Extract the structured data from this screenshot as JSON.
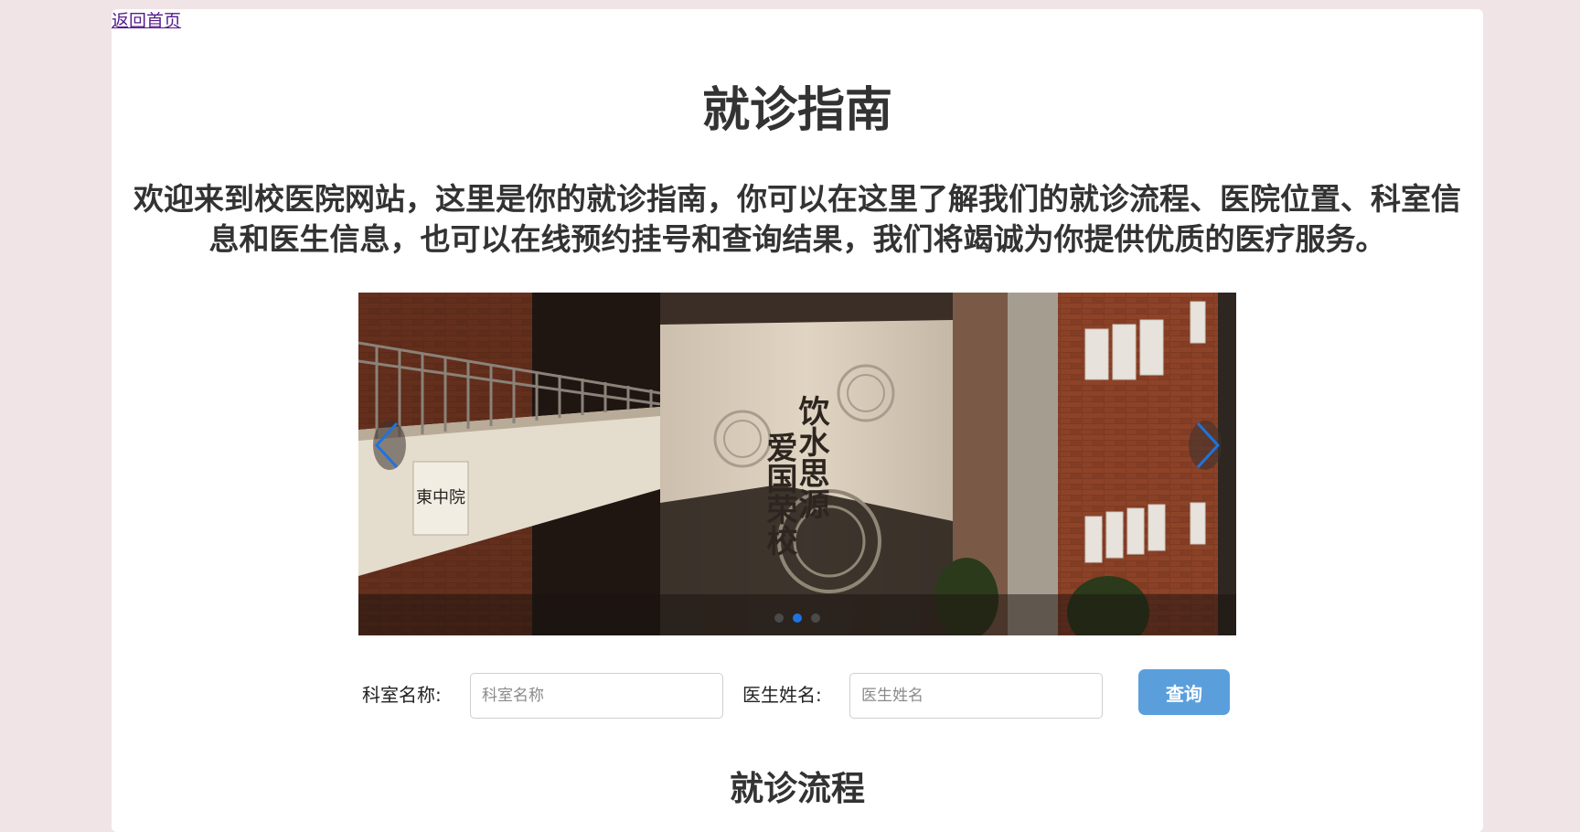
{
  "nav": {
    "back_home": "返回首页"
  },
  "page": {
    "title": "就诊指南",
    "intro": "欢迎来到校医院网站，这里是你的就诊指南，你可以在这里了解我们的就诊流程、医院位置、科室信息和医生信息，也可以在线预约挂号和查询结果，我们将竭诚为你提供优质的医疗服务。"
  },
  "carousel": {
    "slide_count": 3,
    "active_index": 1,
    "slide_text": {
      "plaque": "東中院",
      "motto_line1": "饮水思源",
      "motto_line2": "爱国荣校"
    },
    "prev_icon": "chevron-left-icon",
    "next_icon": "chevron-right-icon",
    "accent_color": "#1e73e0"
  },
  "search": {
    "department_label": "科室名称:",
    "department_placeholder": "科室名称",
    "department_value": "",
    "doctor_label": "医生姓名:",
    "doctor_placeholder": "医生姓名",
    "doctor_value": "",
    "submit_label": "查询",
    "button_color": "#5a9fdc"
  },
  "sections": {
    "process_title": "就诊流程"
  }
}
